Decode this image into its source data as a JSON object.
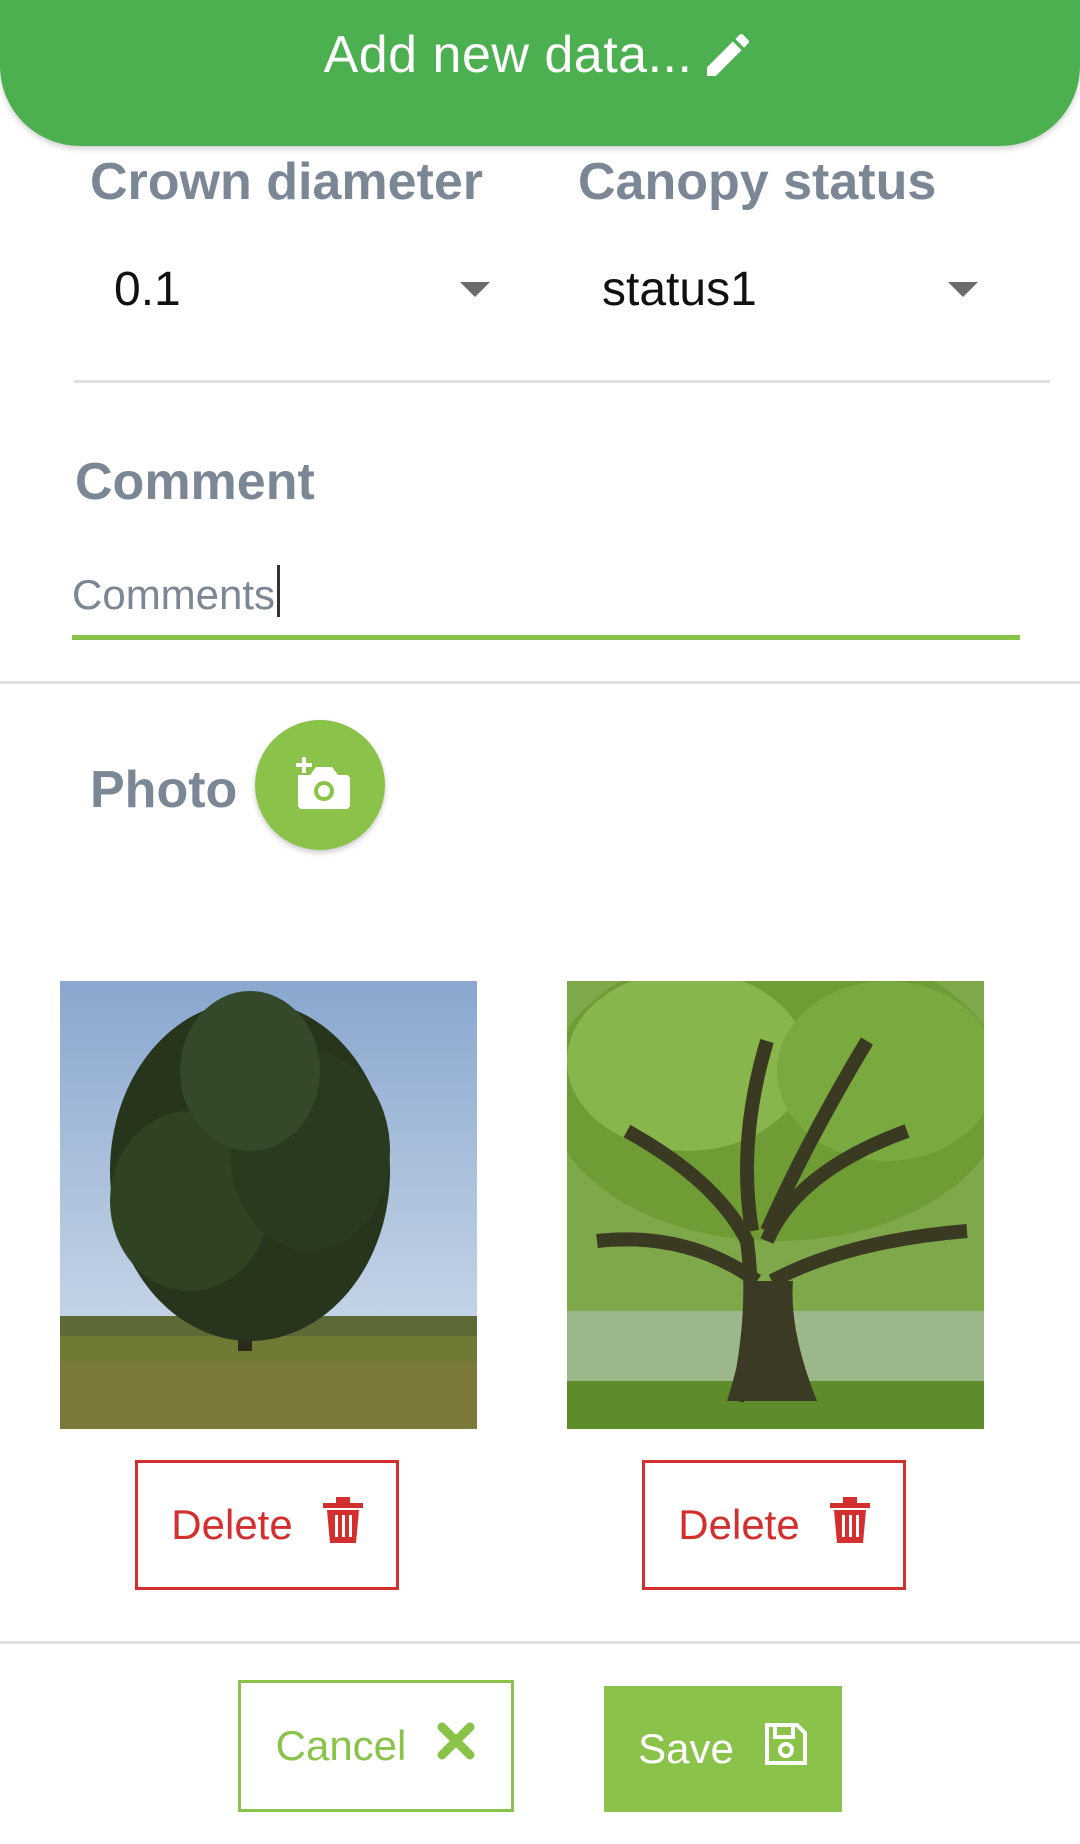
{
  "header": {
    "title": "Add new data..."
  },
  "fields": {
    "crown_diameter": {
      "label": "Crown diameter",
      "value": "0.1"
    },
    "canopy_status": {
      "label": "Canopy status",
      "value": "status1"
    }
  },
  "comment": {
    "label": "Comment",
    "placeholder": "Comments"
  },
  "photo": {
    "label": "Photo"
  },
  "photos": [
    {
      "delete_label": "Delete"
    },
    {
      "delete_label": "Delete"
    }
  ],
  "actions": {
    "cancel_label": "Cancel",
    "save_label": "Save"
  },
  "colors": {
    "header_green": "#4caf50",
    "accent_green": "#8bc34a",
    "label_gray": "#7b8794",
    "delete_red": "#d32f2f"
  },
  "icons": {
    "header": "pencil-icon",
    "photo_button": "add-photo-icon",
    "delete": "trash-icon",
    "cancel": "close-icon",
    "save": "floppy-disk-icon"
  }
}
